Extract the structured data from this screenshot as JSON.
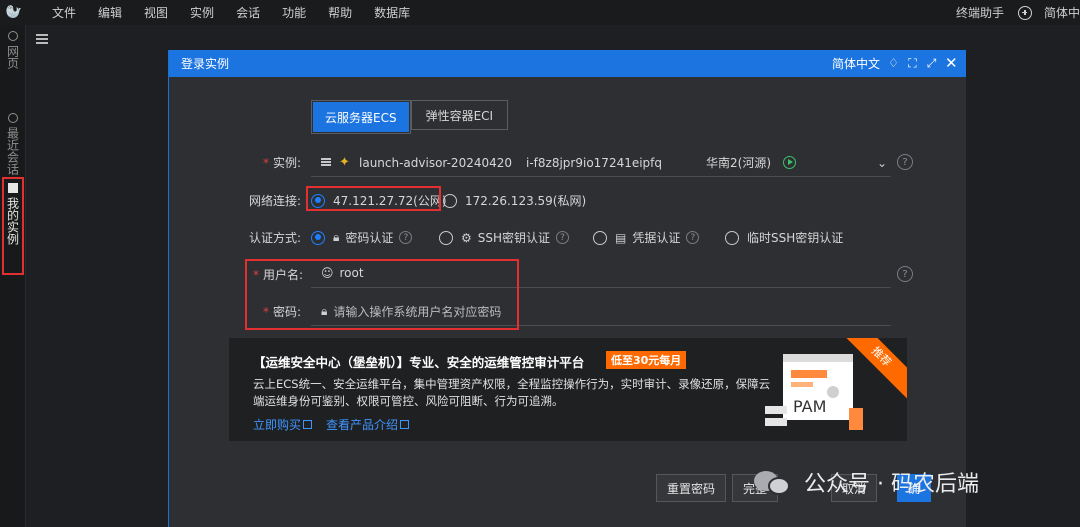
{
  "menubar": {
    "items": [
      "文件",
      "编辑",
      "视图",
      "实例",
      "会话",
      "功能",
      "帮助",
      "数据库"
    ],
    "right_text_1": "终端助手",
    "right_text_2": "简体中"
  },
  "sidebar": {
    "tabs": [
      "网页",
      "最近会话",
      "我的实例"
    ]
  },
  "modal": {
    "title": "登录实例",
    "language": "简体中文",
    "tabs": [
      "云服务器ECS",
      "弹性容器ECI"
    ],
    "instance": {
      "label": "实例:",
      "name": "launch-advisor-20240420",
      "id": "i-f8z8jpr9io17241eipfq",
      "region": "华南2(河源)"
    },
    "network": {
      "label": "网络连接:",
      "public": "47.121.27.72(公网)",
      "private": "172.26.123.59(私网)"
    },
    "auth": {
      "label": "认证方式:",
      "options": [
        "密码认证",
        "SSH密钥认证",
        "凭据认证",
        "临时SSH密钥认证"
      ]
    },
    "username": {
      "label": "用户名:",
      "value": "root"
    },
    "password": {
      "label": "密码:",
      "placeholder": "请输入操作系统用户名对应密码"
    },
    "banner": {
      "title": "【运维安全中心（堡垒机）】专业、安全的运维管控审计平台",
      "promo": "低至30元每月",
      "desc": "云上ECS统一、安全运维平台，集中管理资产权限，全程监控操作行为，实时审计、录像还原，保障云端运维身份可鉴别、权限可管控、风险可阻断、行为可追溯。",
      "link_buy": "立即购买",
      "link_docs": "查看产品介绍",
      "ribbon": "推荐",
      "pam_text": "PAM"
    },
    "buttons": {
      "reset": "重置密码",
      "complete": "完整",
      "cancel": "取消",
      "ok": "确"
    }
  },
  "watermark": {
    "text": "公众号 · 码农后端"
  }
}
